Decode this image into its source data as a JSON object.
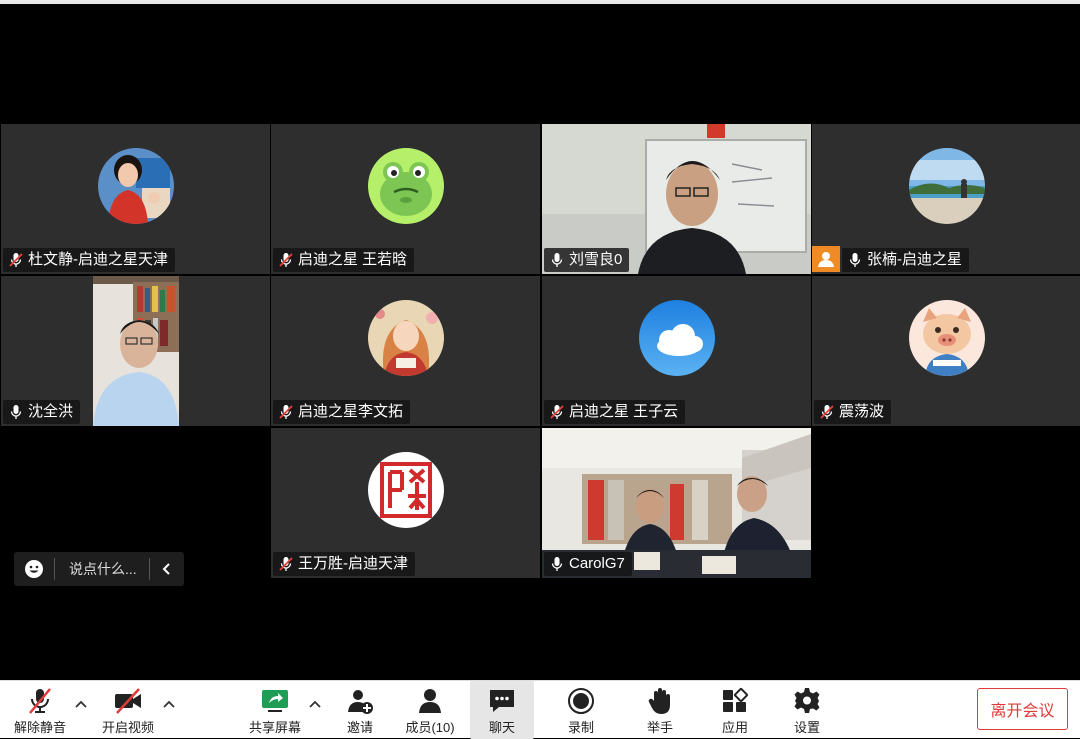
{
  "participants": [
    {
      "name": "杜文静-启迪之星天津",
      "muted": true
    },
    {
      "name": "启迪之星 王若晗",
      "muted": true
    },
    {
      "name": "刘雪良0",
      "muted": false
    },
    {
      "name": "张楠-启迪之星",
      "muted": false
    },
    {
      "name": "沈全洪",
      "muted": false
    },
    {
      "name": "启迪之星李文拓",
      "muted": true
    },
    {
      "name": "启迪之星 王子云",
      "muted": true
    },
    {
      "name": "震荡波",
      "muted": true
    },
    {
      "name": "王万胜-启迪天津",
      "muted": true
    },
    {
      "name": "CarolG7",
      "muted": false
    }
  ],
  "chat": {
    "placeholder": "说点什么..."
  },
  "toolbar": {
    "unmute": "解除静音",
    "start_video": "开启视频",
    "share_screen": "共享屏幕",
    "invite": "邀请",
    "members": "成员(10)",
    "chat": "聊天",
    "record": "录制",
    "raise_hand": "举手",
    "apps": "应用",
    "settings": "设置",
    "leave": "离开会议"
  },
  "colors": {
    "accent": "#36c36f",
    "leave": "#e03a3a",
    "host_badge": "#f08a24",
    "tile_bg": "#2e2e2f"
  }
}
